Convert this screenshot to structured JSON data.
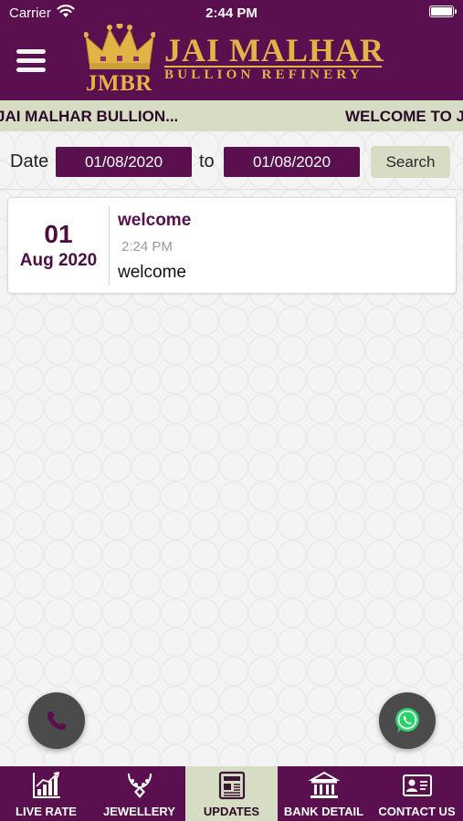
{
  "status_bar": {
    "carrier": "Carrier",
    "time": "2:44 PM"
  },
  "logo": {
    "abbr": "JMBR",
    "name": "JAI MALHAR",
    "subtitle": "BULLION REFINERY"
  },
  "marquee": {
    "left_text": "JAI MALHAR BULLION...",
    "right_text": "WELCOME TO J"
  },
  "filter": {
    "date_label": "Date",
    "from_date": "01/08/2020",
    "to_label": "to",
    "to_date": "01/08/2020",
    "search_label": "Search"
  },
  "updates": [
    {
      "day": "01",
      "month_year": "Aug 2020",
      "title": "welcome",
      "time": "2:24 PM",
      "message": "welcome"
    }
  ],
  "tabs": [
    {
      "label": "LIVE RATE",
      "icon": "bar-chart-icon",
      "active": false
    },
    {
      "label": "JEWELLERY",
      "icon": "necklace-icon",
      "active": false
    },
    {
      "label": "UPDATES",
      "icon": "newspaper-icon",
      "active": true
    },
    {
      "label": "BANK DETAIL",
      "icon": "bank-icon",
      "active": false
    },
    {
      "label": "CONTACT US",
      "icon": "contact-card-icon",
      "active": false
    }
  ],
  "colors": {
    "primary": "#5a0f4f",
    "accent": "#d7dcc4",
    "gold": "#e0b545",
    "whatsapp": "#25d366"
  }
}
